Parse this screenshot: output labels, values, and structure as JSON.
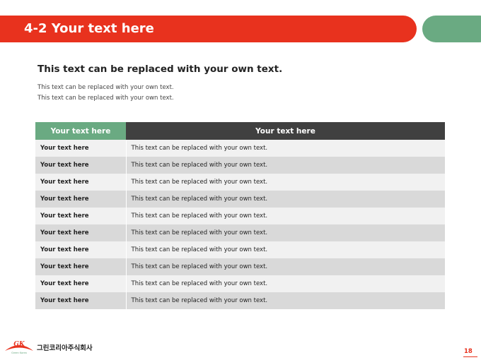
{
  "header": {
    "title": "4-2 Your text here"
  },
  "content": {
    "subtitle": "This text can be replaced with your own text.",
    "desc_lines": [
      "This text can be replaced with your own text.",
      "This text can be replaced with your own text."
    ]
  },
  "table": {
    "headers": [
      "Your text here",
      "Your text here"
    ],
    "rows": [
      {
        "label": "Your text here",
        "text": "This text can be replaced with your own text."
      },
      {
        "label": "Your text here",
        "text": "This text can be replaced with your own text."
      },
      {
        "label": "Your text here",
        "text": "This text can be replaced with your own text."
      },
      {
        "label": "Your text here",
        "text": "This text can be replaced with your own text."
      },
      {
        "label": "Your text here",
        "text": "This text can be replaced with your own text."
      },
      {
        "label": "Your text here",
        "text": "This text can be replaced with your own text."
      },
      {
        "label": "Your text here",
        "text": "This text can be replaced with your own text."
      },
      {
        "label": "Your text here",
        "text": "This text can be replaced with your own text."
      },
      {
        "label": "Your text here",
        "text": "This text can be replaced with your own text."
      },
      {
        "label": "Your text here",
        "text": "This text can be replaced with your own text."
      }
    ]
  },
  "footer": {
    "logo_mark": "GK",
    "logo_tagline": "Green Korea",
    "company": "그린코리아주식회사",
    "page_number": "18"
  },
  "colors": {
    "accent_red": "#e8321e",
    "accent_green": "#6aaa82",
    "header_dark": "#404040"
  }
}
